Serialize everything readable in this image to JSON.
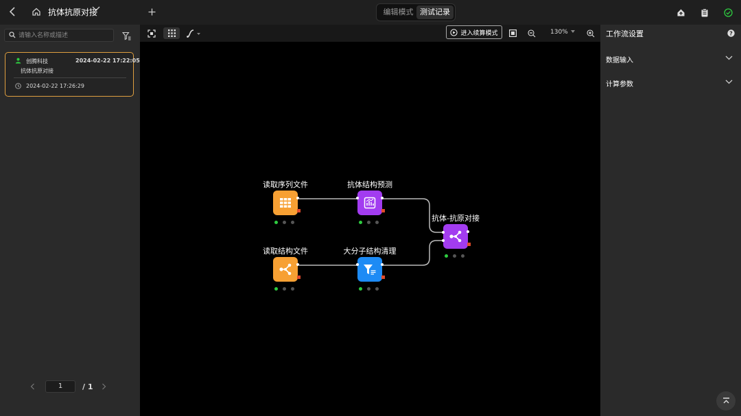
{
  "header": {
    "title": "抗体抗原对接",
    "modes": {
      "edit": "编辑模式",
      "test": "测试记录"
    }
  },
  "sidebar": {
    "search_placeholder": "请输入名称或描述",
    "record": {
      "owner": "创腾科技",
      "created": "2024-02-22 17:22:05",
      "flow_name": "抗体抗原对接",
      "run_time": "2024-02-22 17:26:29"
    },
    "pager": {
      "current": "1",
      "total": "/ 1"
    }
  },
  "toolbar": {
    "calc_mode_label": "进入续算模式",
    "zoom": "130%"
  },
  "nodes": {
    "read_seq": "读取序列文件",
    "antibody_pred": "抗体结构预测",
    "read_struct": "读取结构文件",
    "macro_clean": "大分子结构清理",
    "docking": "抗体-抗原对接"
  },
  "settings": {
    "title": "工作流设置",
    "sections": [
      "数据输入",
      "计算参数"
    ]
  },
  "colors": {
    "orange": "#f7a033",
    "purple": "#a23cf0",
    "blue": "#1d8bf5",
    "accent_border": "#e0a040",
    "ok_green": "#2ecc40"
  }
}
